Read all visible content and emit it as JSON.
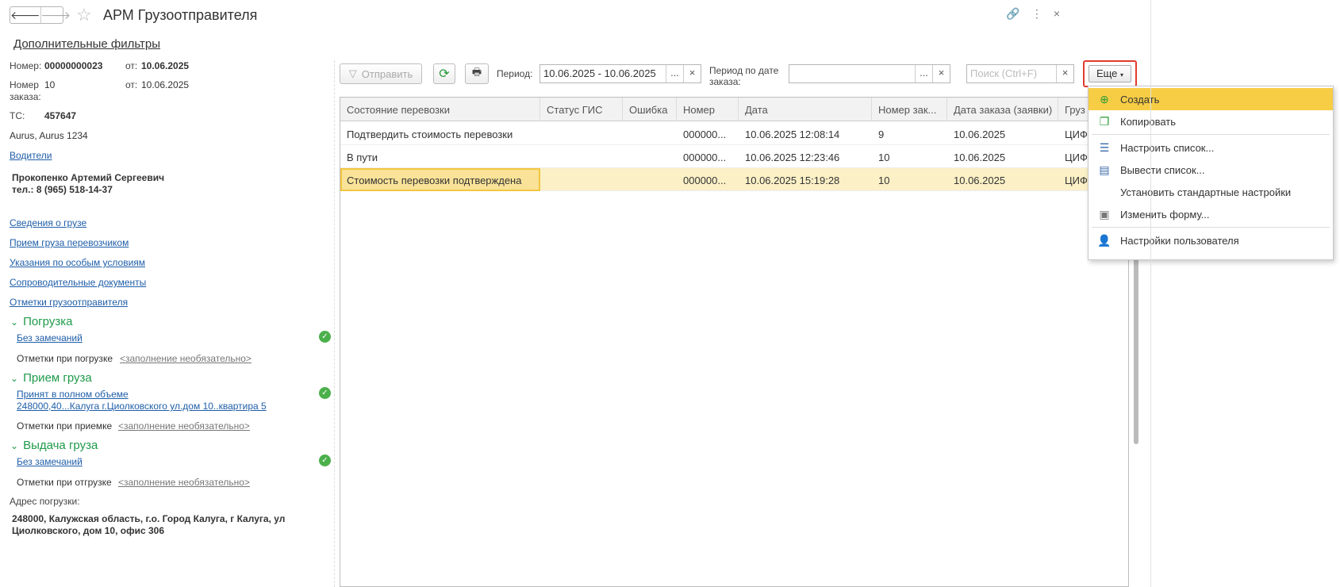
{
  "window": {
    "title": "АРМ Грузоотправителя",
    "back": "🡐",
    "forward": "🡒",
    "link_icon": "🔗",
    "more_icon": "⋮",
    "close_icon": "×"
  },
  "filters_link": "Дополнительные фильтры",
  "left": {
    "number_label": "Номер:",
    "number_value": "00000000023",
    "number_date_label": "от:",
    "number_date": "10.06.2025",
    "order_label": "Номер заказа:",
    "order_value": "10",
    "order_date_label": "от:",
    "order_date": "10.06.2025",
    "ts_label": "ТС:",
    "ts_value": "457647",
    "ts_model": "Aurus, Aurus 1234",
    "drivers_link": "Водители",
    "driver_name": "Прокопенко Артемий Сергеевич",
    "driver_phone": "тел.: 8 (965) 518-14-37",
    "links": [
      "Сведения о грузе",
      "Прием груза перевозчиком",
      "Указания по особым условиям",
      "Сопроводительные документы",
      "Отметки грузоотправителя"
    ],
    "loading": {
      "title": "Погрузка",
      "status": "Без замечаний",
      "marks_label": "Отметки при погрузке",
      "marks_value": "<заполнение необязательно>"
    },
    "receipt": {
      "title": "Прием груза",
      "status_line1": "Принят в полном объеме",
      "status_line2": "248000,40...Калуга г.Циолковского ул.дом 10..квартира 5",
      "marks_label": "Отметки при приемке",
      "marks_value": "<заполнение необязательно>"
    },
    "delivery": {
      "title": "Выдача груза",
      "status": "Без замечаний",
      "marks_label": "Отметки при отгрузке",
      "marks_value": "<заполнение необязательно>"
    },
    "address_label": "Адрес погрузки:",
    "address_line1": "248000, Калужская область, г.о. Город Калуга, г Калуга, ул",
    "address_line2": "Циолковского, дом 10, офис 306"
  },
  "toolbar": {
    "send": "Отправить",
    "period_label": "Период:",
    "period_value": "10.06.2025 - 10.06.2025",
    "order_period_label1": "Период по дате",
    "order_period_label2": "заказа:",
    "order_period_value": "",
    "search_placeholder": "Поиск (Ctrl+F)",
    "more": "Еще",
    "dots": "...",
    "clear": "×",
    "refresh_icon": "⟳",
    "print_icon": "🖶"
  },
  "table": {
    "columns": [
      "Состояние перевозки",
      "Статус ГИС",
      "Ошибка",
      "Номер",
      "Дата",
      "Номер зак...",
      "Дата заказа (заявки)",
      "Груз"
    ],
    "rows": [
      [
        "Подтвердить стоимость перевозки",
        "",
        "",
        "000000...",
        "10.06.2025 12:08:14",
        "9",
        "10.06.2025",
        "ЦИФ"
      ],
      [
        "В пути",
        "",
        "",
        "000000...",
        "10.06.2025 12:23:46",
        "10",
        "10.06.2025",
        "ЦИФ"
      ],
      [
        "Стоимость перевозки подтверждена",
        "",
        "",
        "000000...",
        "10.06.2025 15:19:28",
        "10",
        "10.06.2025",
        "ЦИФ"
      ]
    ]
  },
  "menu": {
    "items": [
      "Создать",
      "Копировать",
      "Настроить список...",
      "Вывести список...",
      "Установить стандартные настройки",
      "Изменить форму...",
      "Настройки пользователя"
    ]
  },
  "colors": {
    "accent": "#f7cd45",
    "green": "#1e9a4a",
    "link": "#1f5ea8",
    "highlight_border": "#e03b2e"
  }
}
